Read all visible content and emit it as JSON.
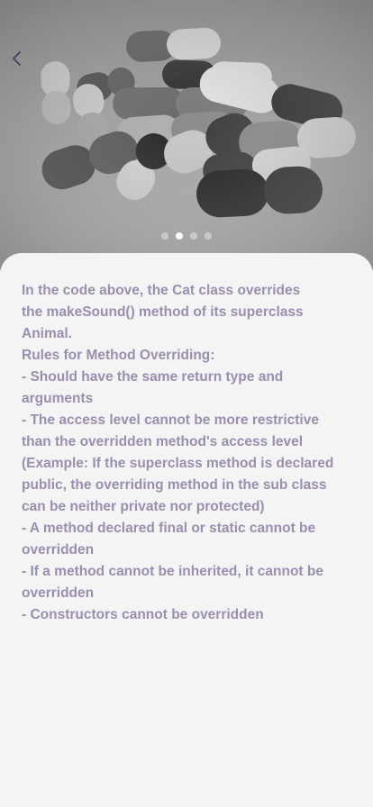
{
  "hero": {
    "image": "capsules-pills-photo",
    "back_icon": "chevron-left-icon",
    "carousel": {
      "count": 4,
      "active_index": 1
    }
  },
  "colors": {
    "text": "#9a8fae",
    "background": "#f4f4f4",
    "back_icon": "#4a3a6a",
    "dot_active": "#ffffff",
    "dot_inactive": "#c9c9c9"
  },
  "content": {
    "lines": [
      "In the code above, the Cat class overrides",
      "the makeSound() method of its superclass",
      "Animal.",
      "Rules for Method Overriding:",
      "- Should have the same return type and",
      "arguments",
      "- The access level cannot be more restrictive",
      "than the overridden method's access level",
      "(Example: If the superclass method is declared",
      "public, the overriding method in the sub class",
      "can be neither private nor protected)",
      "- A method declared final or static cannot be",
      "overridden",
      "- If a method cannot be inherited, it cannot be",
      "overridden",
      "- Constructors cannot be overridden"
    ]
  }
}
